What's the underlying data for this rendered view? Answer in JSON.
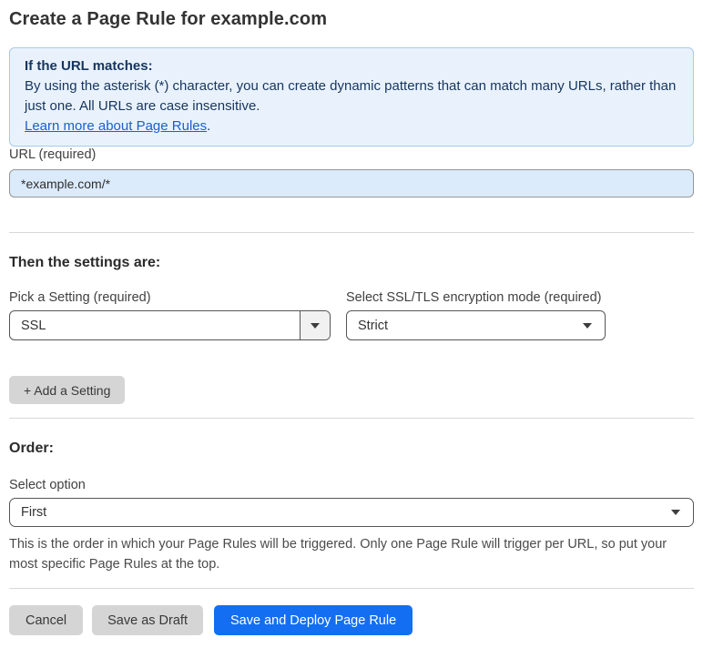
{
  "page": {
    "title": "Create a Page Rule for example.com"
  },
  "info_box": {
    "heading": "If the URL matches:",
    "body": "By using the asterisk (*) character, you can create dynamic patterns that can match many URLs, rather than just one. All URLs are case insensitive.",
    "link_label": "Learn more about Page Rules",
    "link_suffix": "."
  },
  "url_field": {
    "label": "URL (required)",
    "value": "*example.com/*"
  },
  "settings_section": {
    "heading": "Then the settings are:",
    "setting_picker": {
      "label": "Pick a Setting (required)",
      "value": "SSL"
    },
    "ssl_mode_picker": {
      "label": "Select SSL/TLS encryption mode (required)",
      "value": "Strict"
    },
    "add_setting_label": "+ Add a Setting"
  },
  "order_section": {
    "heading": "Order:",
    "select_label": "Select option",
    "value": "First",
    "help_text": "This is the order in which your Page Rules will be triggered. Only one Page Rule will trigger per URL, so put your most specific Page Rules at the top."
  },
  "actions": {
    "cancel_label": "Cancel",
    "save_draft_label": "Save as Draft",
    "save_deploy_label": "Save and Deploy Page Rule"
  },
  "colors": {
    "accent_blue": "#146ef2",
    "info_bg": "#e9f2fc",
    "info_border": "#a9c9ea",
    "info_text": "#16355f",
    "link_blue": "#1b5fce",
    "input_bg": "#dcebfc",
    "button_gray": "#d5d5d5"
  },
  "icons": {
    "caret_down": "caret-down-icon"
  }
}
